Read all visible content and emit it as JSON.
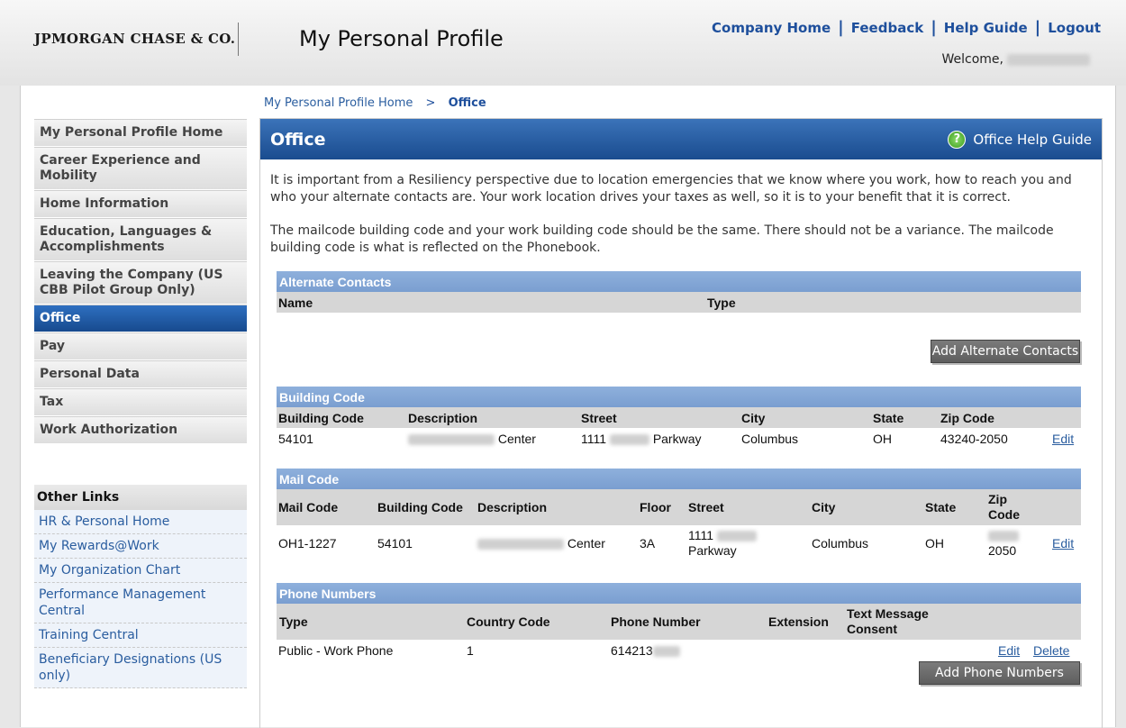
{
  "header": {
    "logo": "JPMORGAN CHASE & CO.",
    "title": "My Personal Profile",
    "links": [
      "Company Home",
      "Feedback",
      "Help Guide",
      "Logout"
    ],
    "welcome": "Welcome,"
  },
  "breadcrumb": {
    "home": "My Personal Profile Home",
    "separator": ">",
    "current": "Office"
  },
  "sidebar": {
    "items": [
      "My Personal Profile Home",
      "Career Experience and Mobility",
      "Home Information",
      "Education, Languages & Accomplishments",
      "Leaving the Company (US CBB Pilot Group Only)",
      "Office",
      "Pay",
      "Personal Data",
      "Tax",
      "Work Authorization"
    ],
    "active": "Office"
  },
  "other_links": {
    "title": "Other Links",
    "items": [
      "HR & Personal Home",
      "My Rewards@Work",
      "My Organization Chart",
      "Performance Management Central",
      "Training Central",
      "Beneficiary Designations (US only)"
    ]
  },
  "content": {
    "title": "Office",
    "help_label": "Office Help Guide",
    "help_icon": "?",
    "paragraph1": "It is important from a Resiliency perspective due to location emergencies that we know where you work, how to reach you and who your alternate contacts are. Your work location drives your taxes as well, so it is to your benefit that it is correct.",
    "paragraph2": "The mailcode building code and your work building code should be the same. There should not be a variance. The mailcode building code is what is reflected on the Phonebook."
  },
  "alternate_contacts": {
    "title": "Alternate Contacts",
    "columns": [
      "Name",
      "Type"
    ],
    "button": "Add Alternate Contacts"
  },
  "building_code": {
    "title": "Building Code",
    "columns": [
      "Building Code",
      "Description",
      "Street",
      "City",
      "State",
      "Zip Code"
    ],
    "row": {
      "building_code": "54101",
      "description": "Center",
      "street_prefix": "1111",
      "street_suffix": "Parkway",
      "city": "Columbus",
      "state": "OH",
      "zip": "43240-2050",
      "edit": "Edit"
    }
  },
  "mail_code": {
    "title": "Mail Code",
    "columns": [
      "Mail Code",
      "Building Code",
      "Description",
      "Floor",
      "Street",
      "City",
      "State",
      "Zip Code"
    ],
    "row": {
      "mail_code": "OH1-1227",
      "building_code": "54101",
      "description": "Center",
      "floor": "3A",
      "street_prefix": "1111",
      "street_suffix": "Parkway",
      "city": "Columbus",
      "state": "OH",
      "zip_suffix": "2050",
      "edit": "Edit"
    }
  },
  "phone_numbers": {
    "title": "Phone Numbers",
    "columns": [
      "Type",
      "Country Code",
      "Phone Number",
      "Extension",
      "Text Message Consent"
    ],
    "row": {
      "type": "Public - Work Phone",
      "country_code": "1",
      "phone_prefix": "614213",
      "edit": "Edit",
      "delete": "Delete"
    },
    "button": "Add Phone Numbers"
  }
}
